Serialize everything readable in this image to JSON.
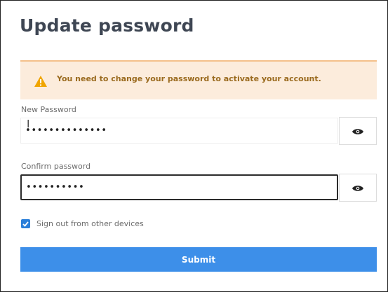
{
  "form": {
    "title": "Update password",
    "alert": {
      "icon": "warning-icon",
      "text": "You need to change your password to activate your account.",
      "icon_color": "#f0a500"
    },
    "new_password": {
      "label": "New Password",
      "value": "••••••••••••••",
      "toggle_icon": "eye-icon"
    },
    "confirm_password": {
      "label": "Confirm password",
      "value": "••••••••••",
      "toggle_icon": "eye-icon"
    },
    "sign_out_other_devices": {
      "label": "Sign out from other devices",
      "checked": true
    },
    "submit_label": "Submit",
    "colors": {
      "accent": "#3d8fe9",
      "alert_background": "#fcecdc",
      "checkbox": "#2b7fd9"
    }
  }
}
